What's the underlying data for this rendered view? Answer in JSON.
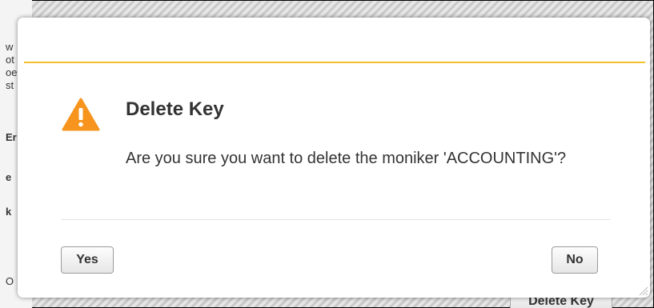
{
  "dialog": {
    "title": "Delete Key",
    "message": "Are you sure you want to delete the moniker 'ACCOUNTING'?",
    "yes_label": "Yes",
    "no_label": "No",
    "icon": "warning-icon",
    "accent_color": "#f2c02e",
    "icon_color": "#f7941d"
  },
  "background": {
    "fragments": [
      {
        "text": "w",
        "bold": false
      },
      {
        "text": "ot",
        "bold": false
      },
      {
        "text": "oe",
        "bold": false
      },
      {
        "text": "st",
        "bold": false
      },
      {
        "text": "Er",
        "bold": true
      },
      {
        "text": "e",
        "bold": true
      },
      {
        "text": "k",
        "bold": true
      },
      {
        "text": "O",
        "bold": false
      }
    ],
    "partial_button_label": "Delete Key"
  }
}
